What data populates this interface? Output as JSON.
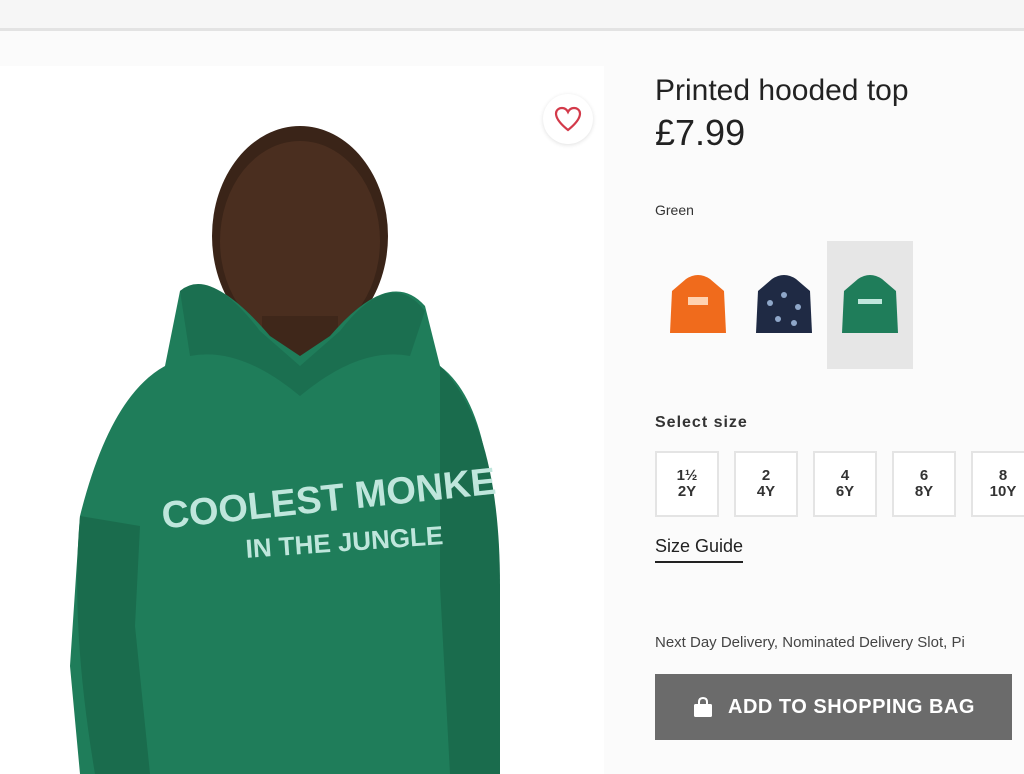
{
  "product": {
    "title": "Printed hooded top",
    "price": "£7.99",
    "selected_color": "Green",
    "colors": [
      {
        "name": "orange",
        "hex": "#f06b1c"
      },
      {
        "name": "navy",
        "hex": "#1f2a44"
      },
      {
        "name": "green",
        "hex": "#1f7d5a"
      }
    ],
    "size_label": "Select size",
    "sizes": [
      {
        "top": "1½",
        "bottom": "2Y"
      },
      {
        "top": "2",
        "bottom": "4Y"
      },
      {
        "top": "4",
        "bottom": "6Y"
      },
      {
        "top": "6",
        "bottom": "8Y"
      },
      {
        "top": "8",
        "bottom": "10Y"
      }
    ],
    "size_guide": "Size Guide",
    "delivery_text": "Next Day Delivery, Nominated Delivery Slot, Pi",
    "add_button": "ADD TO SHOPPING BAG"
  },
  "photo": {
    "print_line1": "COOLEST MONKE",
    "print_line2": "IN THE JUNGLE"
  },
  "icons": {
    "wishlist": "heart-icon",
    "bag": "shopping-bag-icon"
  },
  "colors": {
    "hoodie": "#1f7d5a",
    "button": "#6b6b6b",
    "heart": "#d33a4a"
  }
}
